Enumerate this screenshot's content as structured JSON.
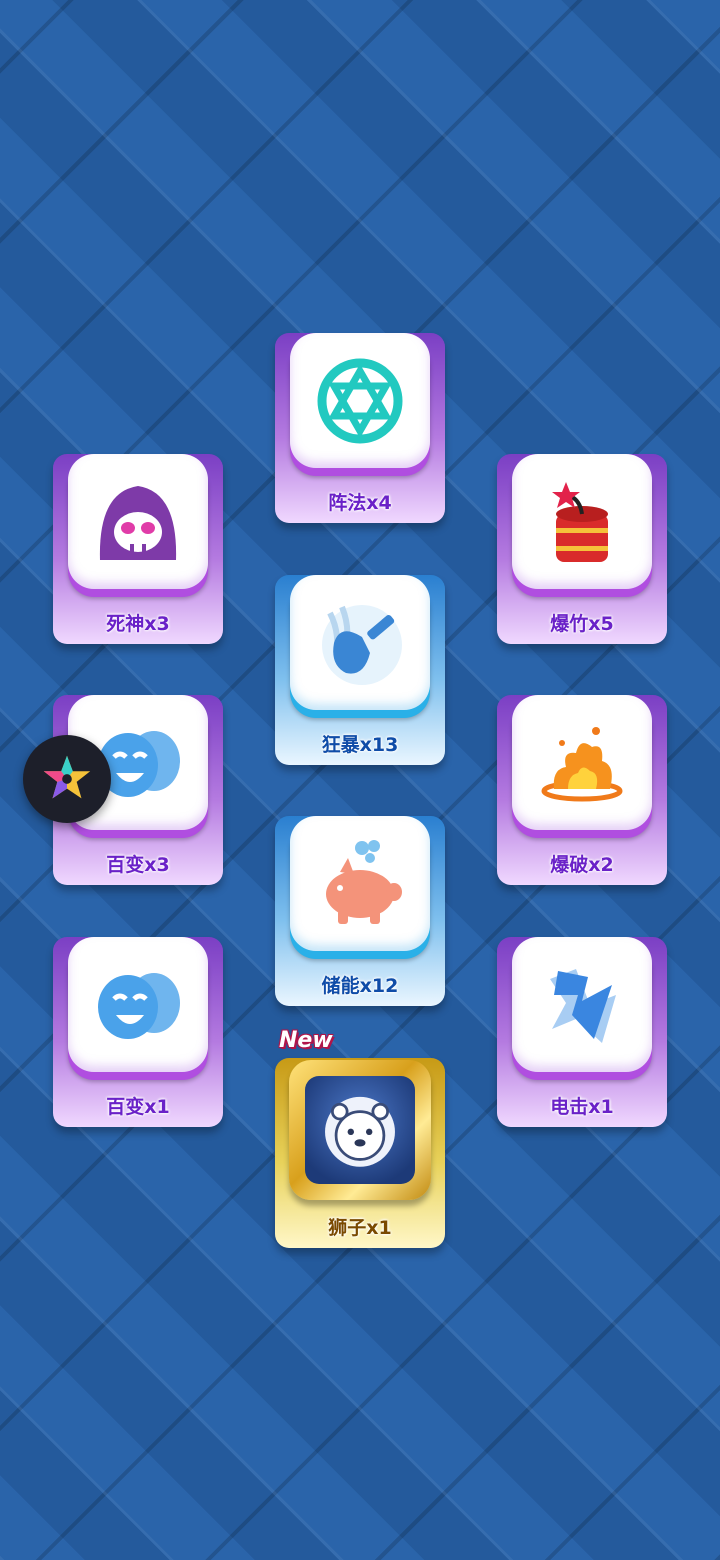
{
  "items": [
    {
      "id": "zhenfa",
      "label": "阵法x4",
      "icon": "hexagram-circle-icon"
    },
    {
      "id": "sishen",
      "label": "死神x3",
      "icon": "reaper-skull-icon"
    },
    {
      "id": "baozhu",
      "label": "爆竹x5",
      "icon": "firecracker-icon"
    },
    {
      "id": "kuangbao",
      "label": "狂暴x13",
      "icon": "hammer-swirl-icon"
    },
    {
      "id": "baibian1",
      "label": "百变x3",
      "icon": "masks-icon"
    },
    {
      "id": "baopo",
      "label": "爆破x2",
      "icon": "explosion-icon"
    },
    {
      "id": "chuneng",
      "label": "储能x12",
      "icon": "piggy-bank-icon"
    },
    {
      "id": "baibian2",
      "label": "百变x1",
      "icon": "masks-icon"
    },
    {
      "id": "dianji",
      "label": "电击x1",
      "icon": "lightning-icon"
    },
    {
      "id": "shizi",
      "label": "狮子x1",
      "icon": "lion-icon",
      "badge": "New"
    }
  ],
  "floating_button": {
    "icon": "star-app-icon"
  }
}
